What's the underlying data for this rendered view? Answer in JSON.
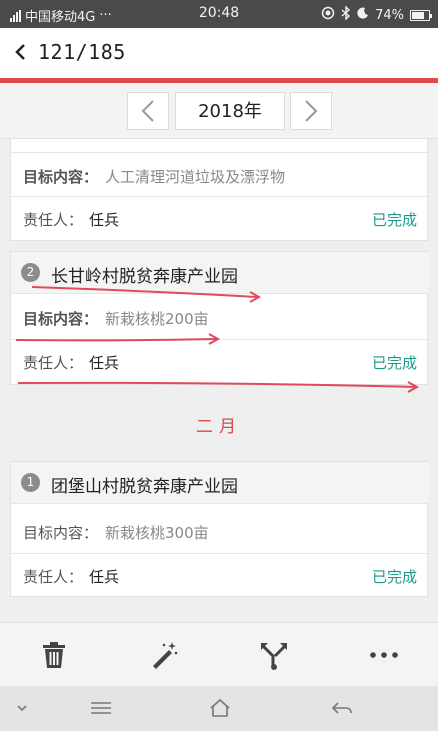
{
  "statusbar": {
    "carrier": "中国移动4G",
    "dots": "···",
    "time": "20:48",
    "battery_text": "74%",
    "battery_level": 0.74,
    "icons": [
      "signal-icon",
      "location-icon",
      "bluetooth-icon",
      "moon-icon",
      "battery-icon"
    ]
  },
  "header": {
    "title": "121/185",
    "back_icon": "chevron-left-icon"
  },
  "year_selector": {
    "year": "2018年",
    "prev_icon": "chevron-left-icon",
    "next_icon": "chevron-right-icon"
  },
  "top_partial_card": {
    "target_label": "目标内容：",
    "target_value": "人工清理河道垃圾及漂浮物",
    "owner_label": "责任人：",
    "owner_value": "任兵",
    "status": "已完成"
  },
  "card_2": {
    "index": "2",
    "title": "长甘岭村脱贫奔康产业园",
    "target_label": "目标内容：",
    "target_value": "新栽核桃200亩",
    "owner_label": "责任人：",
    "owner_value": "任兵",
    "status": "已完成"
  },
  "month_header": "二月",
  "card_feb_1": {
    "index": "1",
    "title": "团堡山村脱贫奔康产业园",
    "target_label": "目标内容：",
    "target_value": "新栽核桃300亩",
    "owner_label": "责任人：",
    "owner_value": "任兵",
    "status": "已完成"
  },
  "toolbar": {
    "icons": [
      "trash-icon",
      "magic-wand-icon",
      "merge-arrows-icon",
      "more-icon"
    ]
  },
  "navbar": {
    "icons": [
      "chevron-down-icon",
      "menu-icon",
      "home-icon",
      "back-icon"
    ]
  },
  "colors": {
    "accent_red": "#e04a4a",
    "status_green": "#1a9a8a",
    "month_red": "#d54a4a"
  }
}
